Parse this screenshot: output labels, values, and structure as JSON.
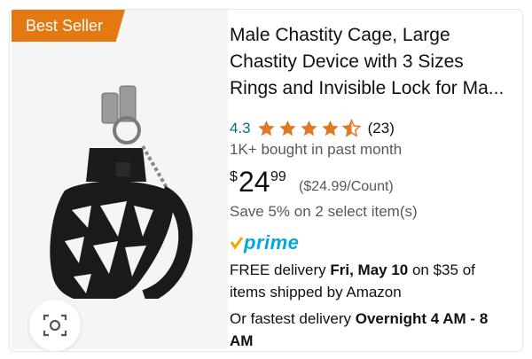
{
  "badge": {
    "label": "Best Seller",
    "color": "#e47911"
  },
  "product": {
    "title": "Male Chastity Cage, Large Chastity Device with 3 Sizes Rings and Invisible Lock for Ma...",
    "rating": "4.3",
    "stars_filled": 4.3,
    "stars_total": 5,
    "review_count": "(23)",
    "bought": "1K+ bought in past month",
    "price": {
      "symbol": "$",
      "whole": "24",
      "fraction": "99",
      "unit_price": "($24.99/Count)"
    },
    "save": "Save 5% on 2 select item(s)"
  },
  "prime": {
    "label": "prime",
    "color": "#00a8e1"
  },
  "delivery": {
    "prefix": "FREE delivery ",
    "date": "Fri, May 10",
    "suffix": " on $35 of items shipped by Amazon"
  },
  "fastest": {
    "prefix": "Or fastest delivery ",
    "time": "Overnight 4 AM - 8 AM"
  },
  "icons": {
    "visual_search": "camera-lens-icon",
    "star": "star-icon",
    "prime_check": "prime-check-icon"
  },
  "colors": {
    "link": "#007185",
    "star": "#de7921",
    "secondary_text": "#565959"
  }
}
